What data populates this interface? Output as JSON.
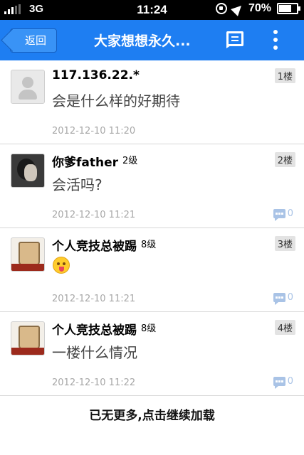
{
  "status_bar": {
    "carrier": "3G",
    "time": "11:24",
    "battery": "70%",
    "battery_level": 0.7,
    "signal_bars_filled": 3,
    "icons": [
      "signal-icon",
      "rotation-lock-icon",
      "location-icon",
      "battery-icon"
    ]
  },
  "nav": {
    "back_label": "返回",
    "title": "大家想想永久...",
    "icons": [
      "reply-list-icon",
      "more-menu-icon"
    ],
    "color": "#1e7ef2"
  },
  "posts": [
    {
      "username": "117.136.22.*",
      "level": "",
      "floor": "1楼",
      "content": "会是什么样的好期待",
      "timestamp": "2012-12-10 11:20",
      "reply_count": "",
      "avatar": "default-avatar"
    },
    {
      "username": "你爹father",
      "level": "2级",
      "floor": "2楼",
      "content": "会活吗?",
      "timestamp": "2012-12-10 11:21",
      "reply_count": "0",
      "avatar": "user-photo-avatar"
    },
    {
      "username": "个人竞技总被踢",
      "level": "8级",
      "floor": "3楼",
      "content": "",
      "emoji": "tongue-out-emoji",
      "timestamp": "2012-12-10 11:21",
      "reply_count": "0",
      "avatar": "glass-photo-avatar"
    },
    {
      "username": "个人竞技总被踢",
      "level": "8级",
      "floor": "4楼",
      "content": "一楼什么情况",
      "timestamp": "2012-12-10 11:22",
      "reply_count": "0",
      "avatar": "glass-photo-avatar"
    }
  ],
  "load_more": "已无更多,点击继续加载"
}
